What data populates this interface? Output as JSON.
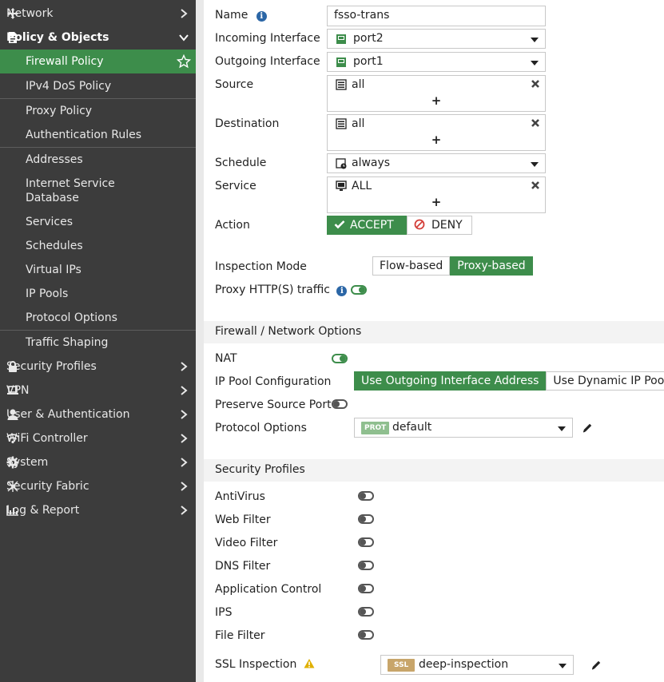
{
  "sidebar": {
    "network": "Network",
    "policy_objects": "Policy & Objects",
    "firewall_policy": "Firewall Policy",
    "ipv4_dos": "IPv4 DoS Policy",
    "proxy_policy": "Proxy Policy",
    "auth_rules": "Authentication Rules",
    "addresses": "Addresses",
    "isdb_line1": "Internet Service",
    "isdb_line2": "Database",
    "services": "Services",
    "schedules": "Schedules",
    "virtual_ips": "Virtual IPs",
    "ip_pools": "IP Pools",
    "protocol_options": "Protocol Options",
    "traffic_shaping": "Traffic Shaping",
    "security_profiles": "Security Profiles",
    "vpn": "VPN",
    "user_auth": "User & Authentication",
    "wifi": "WiFi Controller",
    "system": "System",
    "security_fabric": "Security Fabric",
    "log_report": "Log & Report"
  },
  "form": {
    "name_label": "Name",
    "name_value": "fsso-trans",
    "incoming_label": "Incoming Interface",
    "incoming_value": "port2",
    "outgoing_label": "Outgoing Interface",
    "outgoing_value": "port1",
    "source_label": "Source",
    "source_value": "all",
    "destination_label": "Destination",
    "destination_value": "all",
    "schedule_label": "Schedule",
    "schedule_value": "always",
    "service_label": "Service",
    "service_value": "ALL",
    "plus": "+",
    "action_label": "Action",
    "accept": "ACCEPT",
    "deny": "DENY",
    "inspection_label": "Inspection Mode",
    "flow_based": "Flow-based",
    "proxy_based": "Proxy-based",
    "proxy_http_label": "Proxy HTTP(S) traffic",
    "info_glyph": "i"
  },
  "firewall_section": {
    "title": "Firewall / Network Options",
    "nat_label": "NAT",
    "ippool_label": "IP Pool Configuration",
    "use_outgoing": "Use Outgoing Interface Address",
    "use_dynamic": "Use Dynamic IP Pool",
    "preserve_label": "Preserve Source Port",
    "protocol_label": "Protocol Options",
    "protocol_badge": "PROT",
    "protocol_value": "default"
  },
  "security_section": {
    "title": "Security Profiles",
    "antivirus": "AntiVirus",
    "web_filter": "Web Filter",
    "video_filter": "Video Filter",
    "dns_filter": "DNS Filter",
    "app_control": "Application Control",
    "ips": "IPS",
    "file_filter": "File Filter",
    "ssl_label": "SSL Inspection",
    "ssl_badge": "SSL",
    "ssl_value": "deep-inspection"
  },
  "colors": {
    "accent_green": "#3d8d4b",
    "sidebar_bg": "#3c3c3c",
    "info_blue": "#2b66a6",
    "warning_yellow": "#e0b000",
    "prot_badge": "#8fbf8f",
    "ssl_badge": "#c8a56a"
  }
}
